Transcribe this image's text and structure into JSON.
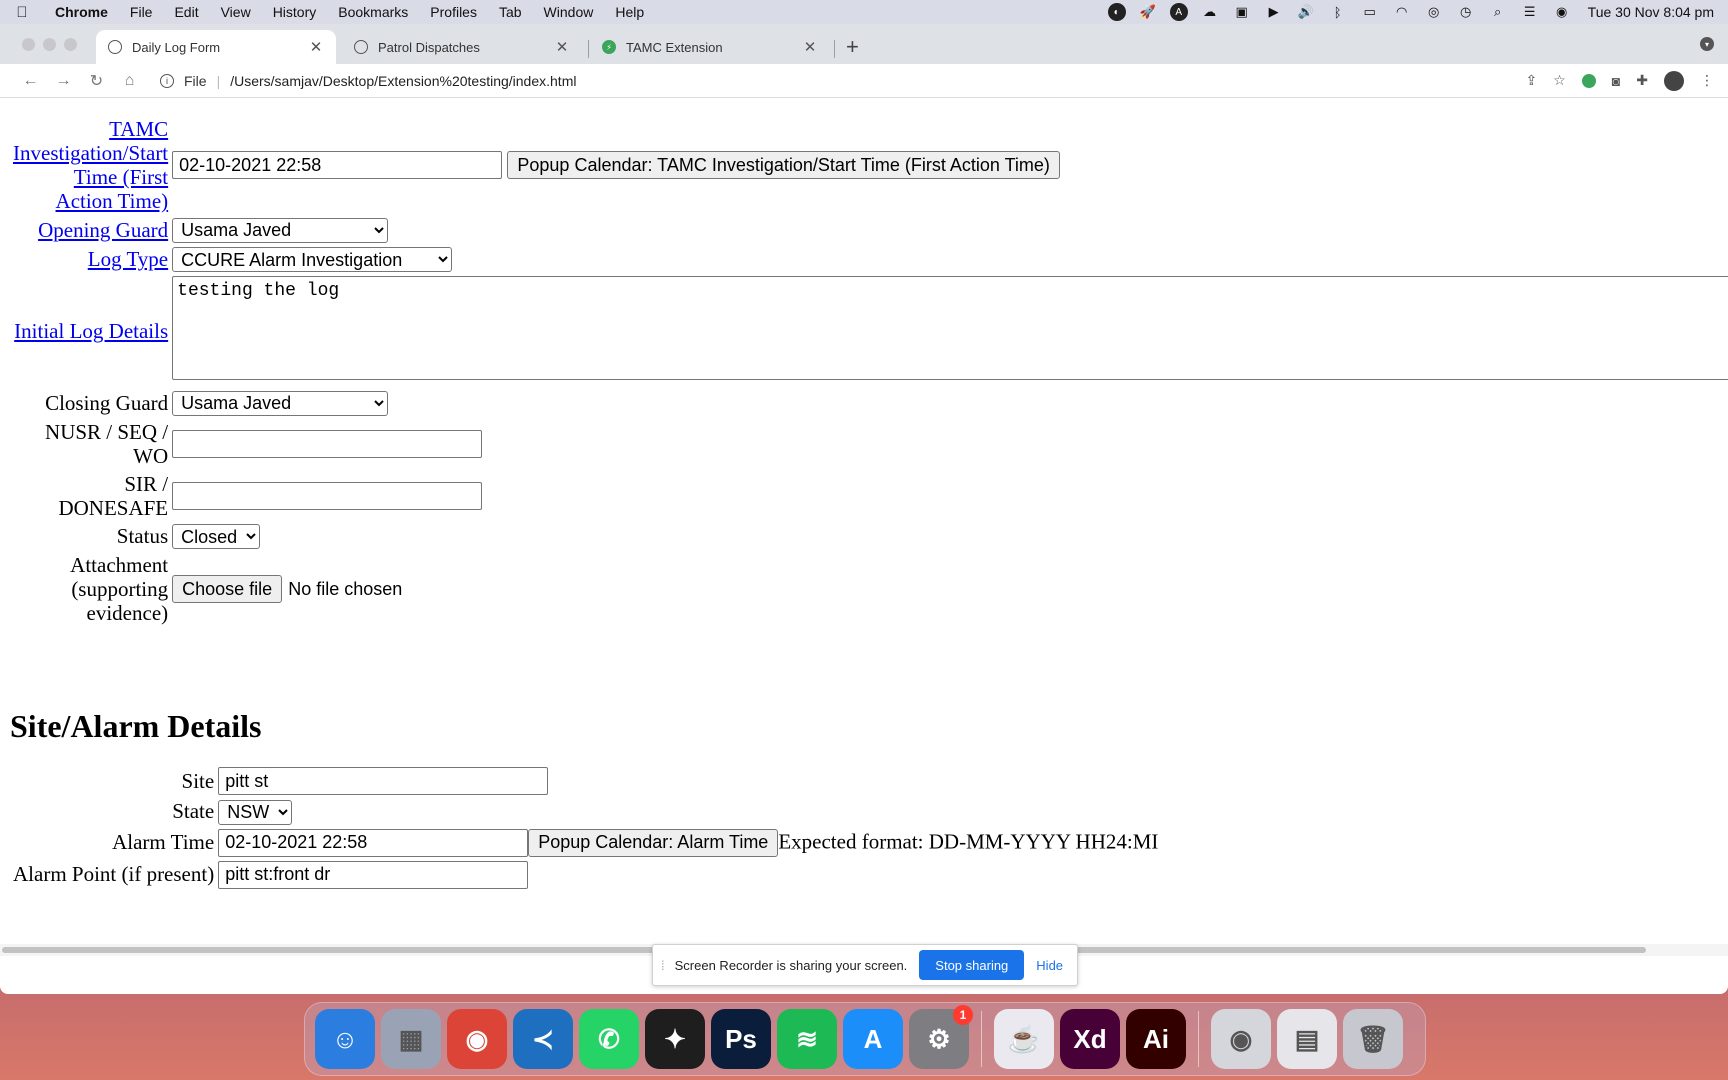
{
  "menubar": {
    "app": "Chrome",
    "items": [
      "File",
      "Edit",
      "View",
      "History",
      "Bookmarks",
      "Profiles",
      "Tab",
      "Window",
      "Help"
    ],
    "clock": "Tue 30 Nov  8:04 pm"
  },
  "tabs": [
    {
      "title": "Daily Log Form",
      "active": true
    },
    {
      "title": "Patrol Dispatches",
      "active": false
    },
    {
      "title": "TAMC Extension",
      "active": false
    }
  ],
  "address": {
    "scheme": "File",
    "url": "/Users/samjav/Desktop/Extension%20testing/index.html"
  },
  "form": {
    "start_time_label": "TAMC Investigation/Start Time (First Action Time)",
    "start_time_value": "02-10-2021 22:58",
    "start_time_button": "Popup Calendar: TAMC Investigation/Start Time (First Action Time)",
    "opening_guard_label": "Opening Guard",
    "opening_guard_value": "Usama Javed",
    "log_type_label": "Log Type",
    "log_type_value": "CCURE Alarm Investigation",
    "initial_log_label": "Initial Log Details",
    "initial_log_value": "testing the log",
    "closing_guard_label": "Closing Guard",
    "closing_guard_value": "Usama Javed",
    "nusr_label": "NUSR / SEQ / WO",
    "nusr_value": "",
    "sir_label": "SIR / DONESAFE",
    "sir_value": "",
    "status_label": "Status",
    "status_value": "Closed",
    "attachment_label": "Attachment (supporting evidence)",
    "attachment_button": "Choose file",
    "attachment_status": "No file chosen"
  },
  "site_section": {
    "heading": "Site/Alarm Details",
    "site_label": "Site",
    "site_value": "pitt st",
    "state_label": "State",
    "state_value": "NSW",
    "alarm_time_label": "Alarm Time",
    "alarm_time_value": "02-10-2021 22:58",
    "alarm_time_button": "Popup Calendar: Alarm Time",
    "alarm_time_hint": "Expected format: DD-MM-YYYY HH24:MI",
    "alarm_point_label": "Alarm Point (if present)",
    "alarm_point_value": "pitt st:front dr"
  },
  "share_banner": {
    "message": "Screen Recorder is sharing your screen.",
    "stop_label": "Stop sharing",
    "hide_label": "Hide"
  },
  "dock": {
    "items": [
      {
        "name": "finder",
        "glyph": "☺",
        "color": "#2b7de0"
      },
      {
        "name": "launchpad",
        "glyph": "▦",
        "color": "#9aa3b5"
      },
      {
        "name": "chrome",
        "glyph": "◉",
        "color": "#db4437"
      },
      {
        "name": "vscode",
        "glyph": "≺",
        "color": "#1f6fc0"
      },
      {
        "name": "whatsapp",
        "glyph": "✆",
        "color": "#25d366"
      },
      {
        "name": "figma",
        "glyph": "✦",
        "color": "#1e1e1e"
      },
      {
        "name": "photoshop",
        "glyph": "Ps",
        "color": "#0a1e3c"
      },
      {
        "name": "spotify",
        "glyph": "≋",
        "color": "#1db954"
      },
      {
        "name": "app-store",
        "glyph": "A",
        "color": "#1c8ef9"
      },
      {
        "name": "system-preferences",
        "glyph": "⚙",
        "color": "#7d7d82",
        "badge": "1"
      },
      {
        "name": "java",
        "glyph": "☕",
        "color": "#e9e9ef"
      },
      {
        "name": "adobe-xd",
        "glyph": "Xd",
        "color": "#470137"
      },
      {
        "name": "illustrator",
        "glyph": "Ai",
        "color": "#330000"
      },
      {
        "name": "chrome-window",
        "glyph": "◉",
        "color": "#d5d5dc"
      },
      {
        "name": "html-file",
        "glyph": "▤",
        "color": "#e6e6ea"
      },
      {
        "name": "trash",
        "glyph": "🗑",
        "color": "#c7c7cf"
      }
    ]
  }
}
